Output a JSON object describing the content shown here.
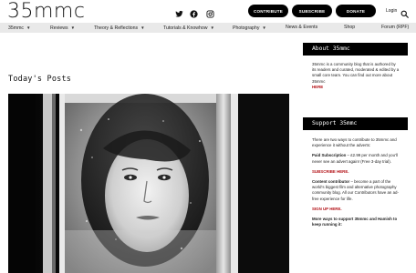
{
  "header": {
    "logo": "35mmc",
    "social_icons": [
      "twitter-icon",
      "facebook-icon",
      "instagram-icon"
    ],
    "buttons": [
      "CONTRIBUTE",
      "SUBSCRIBE",
      "DONATE"
    ],
    "login": "Login"
  },
  "nav": {
    "items": [
      {
        "label": "35mmc",
        "dropdown": true
      },
      {
        "label": "Reviews",
        "dropdown": true
      },
      {
        "label": "Theory & Reflections",
        "dropdown": true
      },
      {
        "label": "Tutorials & Knowhow",
        "dropdown": true
      },
      {
        "label": "Photography",
        "dropdown": true
      },
      {
        "label": "News & Events",
        "dropdown": false
      },
      {
        "label": "Shop",
        "dropdown": false
      },
      {
        "label": "Forum (RPF)",
        "dropdown": false
      }
    ]
  },
  "main": {
    "section_title": "Today's Posts"
  },
  "sidebar": {
    "about": {
      "title": "About 35mmc",
      "text": "35mmc is a community blog that is authored by its readers and curated, moderated & edited by a small core team. You can find out more about 35mmc",
      "link": "HERE"
    },
    "support": {
      "title": "Support 35mmc",
      "intro": "There are two ways to contribute to 35mmc and experience it without the adverts:",
      "paid_label": "Paid Subscription",
      "paid_text": " – £2.99 per month and you'll never see an advert again! (Free 3-day trial).",
      "subscribe_link": "SUBSCRIBE HERE.",
      "contrib_label": "Content contributor",
      "contrib_text": " – become a part of the world's biggest film and alternative photography community blog. All our Contributors have an ad-free experience for life.",
      "signup_link": "SIGN UP HERE.",
      "more": "More ways to support 35mmc and Hamish to keep running it:"
    }
  },
  "colors": {
    "link_red": "#b31217",
    "nav_bg": "#e9e9e9",
    "button_bg": "#000000"
  }
}
